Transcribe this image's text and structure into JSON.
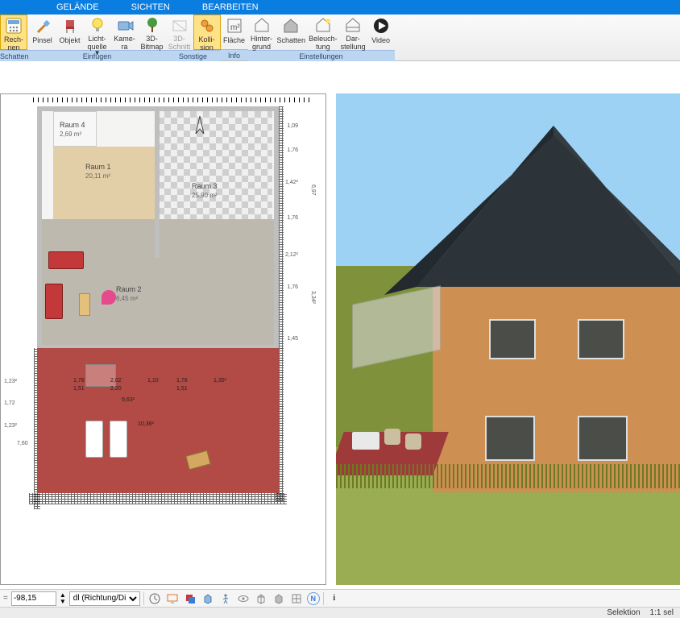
{
  "menu": {
    "gelaende": "GELÄNDE",
    "sichten": "SICHTEN",
    "bearbeiten": "BEARBEITEN"
  },
  "ribbon": {
    "rechnen": "Rech-\nnen",
    "pinsel": "Pinsel",
    "objekt": "Objekt",
    "lichtquelle": "Licht-\nquelle",
    "kamera": "Kame-\nra",
    "bitmap3d": "3D-\nBitmap",
    "schnitt3d": "3D-\nSchnitt",
    "kollision": "Kolli-\nsion",
    "flaeche": "Fläche",
    "hintergrund": "Hinter-\ngrund",
    "schatten": "Schatten",
    "beleuchtung": "Beleuch-\ntung",
    "darstellung": "Dar-\nstellung",
    "video": "Video",
    "groups": {
      "schatten": "Schatten",
      "einfuegen": "Einfügen",
      "sonstige": "Sonstige",
      "info": "Info",
      "einstellungen": "Einstellungen"
    }
  },
  "rooms": {
    "r1": {
      "name": "Raum 1",
      "area": "20,11 m²"
    },
    "r2": {
      "name": "Raum 2",
      "area": "6,45 m²"
    },
    "r3": {
      "name": "Raum 3",
      "area": "25,90 m²"
    },
    "r4": {
      "name": "Raum 4",
      "area": "2,69 m²"
    }
  },
  "dims": {
    "d1": "1,23²",
    "d2": "1,72",
    "d3": "1,23²",
    "d4": "7,60",
    "d5": "1,76",
    "d6": "1,51",
    "d7": "2,02",
    "d8": "2,20",
    "d9": "1,10",
    "d10": "1,76",
    "d11": "1,51",
    "d12": "1,35²",
    "d13": "9,63²",
    "d14": "10,36²",
    "dv1": "1,09",
    "dv2": "1,76",
    "dv3": "1,42²",
    "dv4": "6,97",
    "dv5": "1,76",
    "dv6": "2,12²",
    "dv7": "1,76",
    "dv8": "3,34²",
    "dv9": "1,45"
  },
  "bottom": {
    "coord_value": "-98,15",
    "dir_label": "dl (Richtung/Di"
  },
  "status": {
    "selektion": "Selektion",
    "scale": "1:1 sel"
  }
}
